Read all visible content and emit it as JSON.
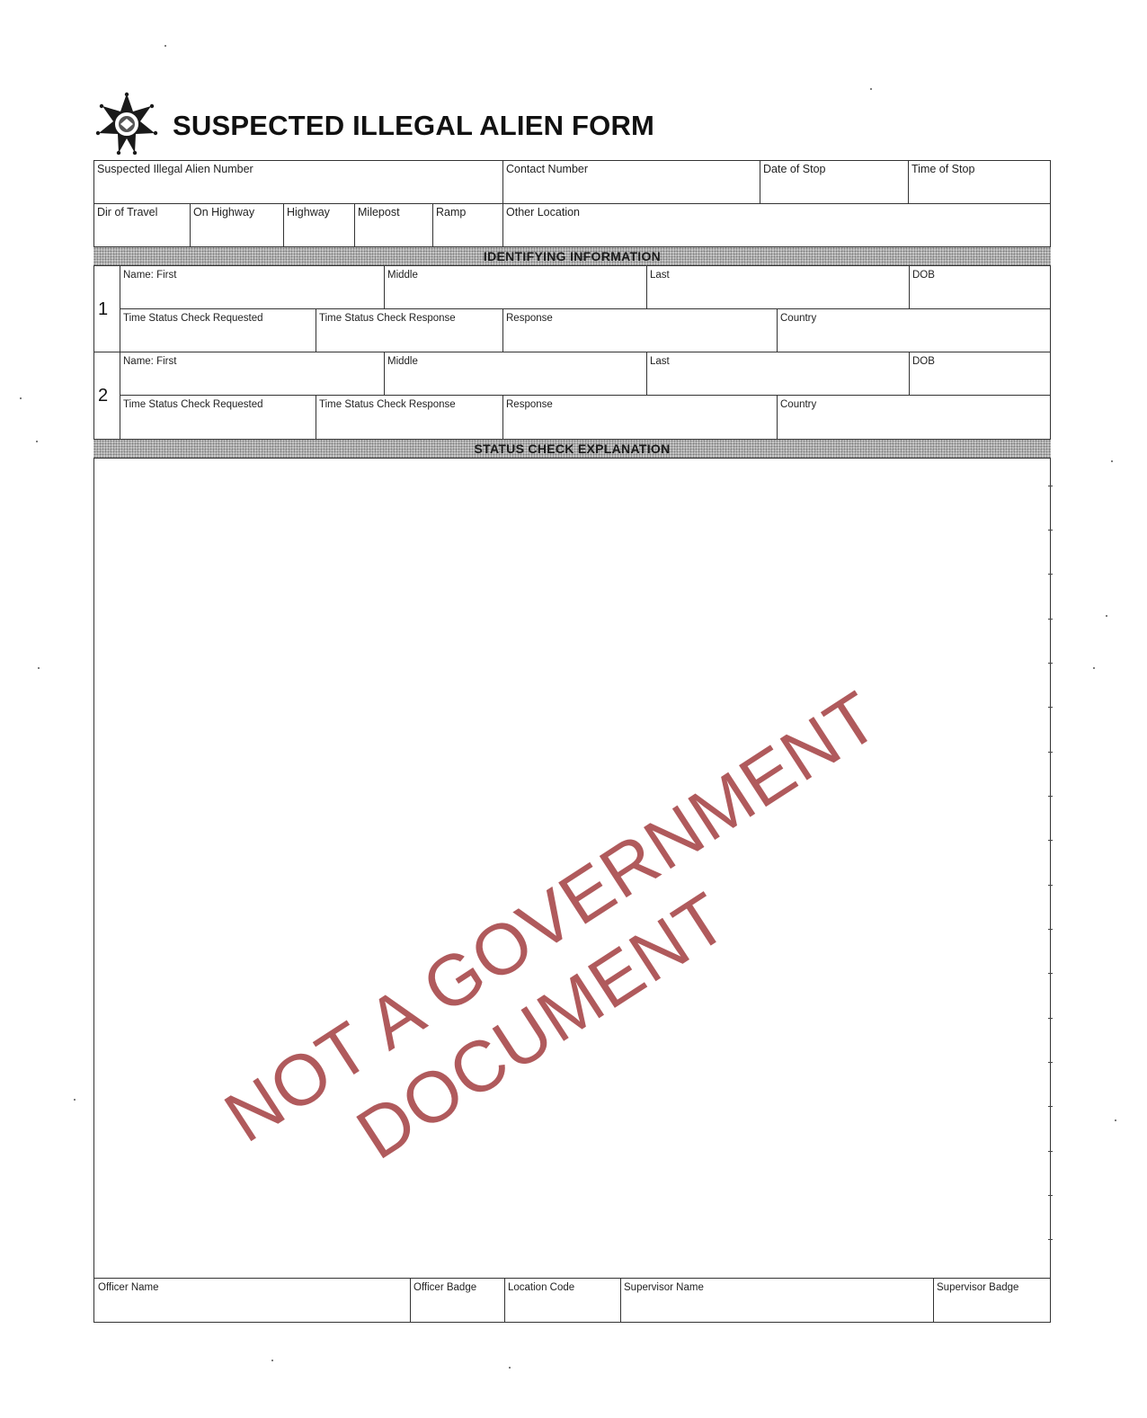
{
  "form": {
    "title": "SUSPECTED ILLEGAL ALIEN FORM",
    "badge_icon": "sheriff-star-badge"
  },
  "header_row1": {
    "alien_number": "Suspected  Illegal Alien Number",
    "contact_number": "Contact Number",
    "date_of_stop": "Date of Stop",
    "time_of_stop": "Time of Stop"
  },
  "header_row2": {
    "dir_of_travel": "Dir of Travel",
    "on_highway": "On Highway",
    "highway": "Highway",
    "milepost": "Milepost",
    "ramp": "Ramp",
    "other_location": "Other Location"
  },
  "sections": {
    "identifying": "IDENTIFYING INFORMATION",
    "status_check": "STATUS CHECK EXPLANATION"
  },
  "persons": [
    {
      "number": "1",
      "name_first": "Name:  First",
      "middle": "Middle",
      "last": "Last",
      "dob": "DOB",
      "time_requested": "Time Status Check Requested",
      "time_response": "Time Status Check Response",
      "response": "Response",
      "country": "Country"
    },
    {
      "number": "2",
      "name_first": "Name:  First",
      "middle": "Middle",
      "last": "Last",
      "dob": "DOB",
      "time_requested": "Time Status Check Requested",
      "time_response": "Time Status Check Response",
      "response": "Response",
      "country": "Country"
    }
  ],
  "footer": {
    "officer_name": "Officer Name",
    "officer_badge": "Officer Badge",
    "location_code": "Location Code",
    "supervisor_name": "Supervisor Name",
    "supervisor_badge": "Supervisor Badge"
  },
  "watermark": {
    "line1": "NOT A GOVERNMENT",
    "line2": "DOCUMENT",
    "color": "#b05a5c"
  }
}
